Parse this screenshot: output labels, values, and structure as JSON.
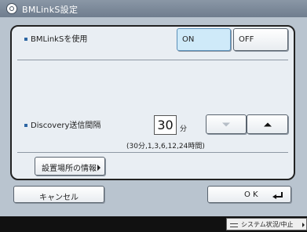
{
  "window": {
    "title": "BMLinkS設定"
  },
  "bmlinks": {
    "label": "BMLinkSを使用",
    "on_label": "ON",
    "off_label": "OFF",
    "selected": "ON"
  },
  "discovery": {
    "label": "Discovery送信間隔",
    "value": "30",
    "unit": "分",
    "hint": "(30分,1,3,6,12,24時間)"
  },
  "location_button": {
    "label": "設置場所の情報"
  },
  "footer": {
    "cancel_label": "キャンセル",
    "ok_label": "O K"
  },
  "status": {
    "label": "システム状況/中止"
  },
  "colors": {
    "screen_bg": "#b9c4cf",
    "selected_bg": "#cfeaf9",
    "bullet": "#2d66a3",
    "status_bar": "#111111"
  },
  "icons": [
    "settings-icon",
    "down-arrow-icon",
    "up-arrow-icon",
    "return-icon",
    "corner-arrow-icon",
    "status-icon"
  ]
}
